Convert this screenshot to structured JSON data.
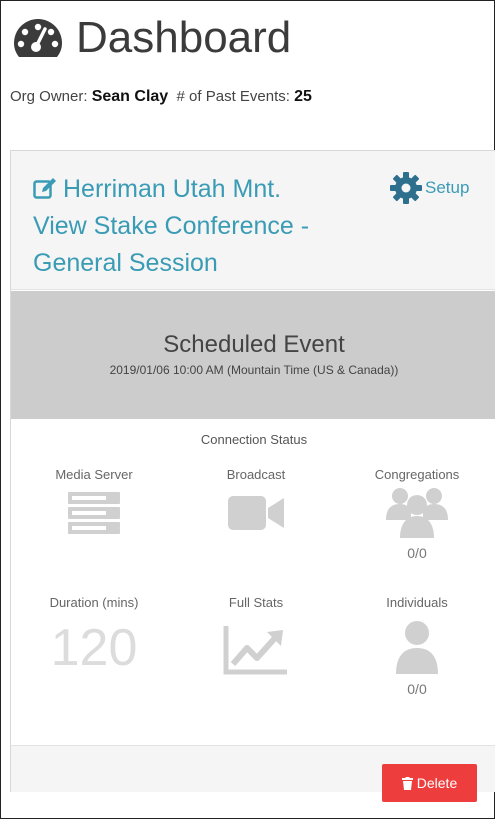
{
  "header": {
    "title": "Dashboard",
    "icon": "tachometer-icon"
  },
  "owner": {
    "label": "Org Owner:",
    "name": "Sean Clay",
    "past_label": "# of Past Events:",
    "past_count": "25"
  },
  "event": {
    "title": "Herriman Utah Mnt. View Stake Conference - General Session",
    "setup_label": "Setup",
    "status_title": "Scheduled Event",
    "status_date": "2019/01/06 10:00 AM (Mountain Time (US & Canada))"
  },
  "connection": {
    "heading": "Connection Status",
    "media_server": "Media Server",
    "broadcast": "Broadcast",
    "congregations": "Congregations",
    "congregations_count": "0/0",
    "duration_label": "Duration (mins)",
    "duration_value": "120",
    "full_stats": "Full Stats",
    "individuals": "Individuals",
    "individuals_count": "0/0"
  },
  "footer": {
    "delete_label": "Delete"
  },
  "colors": {
    "accent": "#3a9bb5",
    "danger": "#ee3d3d",
    "icon_gray": "#cfcfcf",
    "status_bg": "#cccccc"
  }
}
